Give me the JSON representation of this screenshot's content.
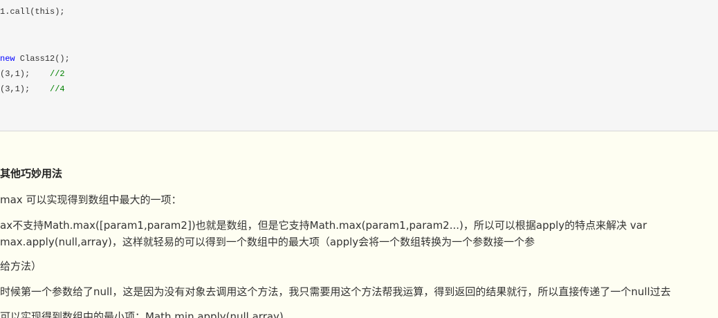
{
  "code": {
    "lines": [
      {
        "code": "1.call(this);",
        "comment": ""
      },
      {
        "code": "",
        "comment": ""
      },
      {
        "code": "",
        "comment": ""
      },
      {
        "kw": "new",
        "code": " Class12();",
        "comment": ""
      },
      {
        "code": "(3,1);    ",
        "comment": "//2"
      },
      {
        "code": "(3,1);    ",
        "comment": "//4"
      }
    ]
  },
  "article": {
    "heading": "其他巧妙用法",
    "p1": "max 可以实现得到数组中最大的一项：",
    "p2a": "ax不支持Math.max([param1,param2])也就是数组，但是它支持Math.max(param1,param2...)，所以可以根据apply的特点来解决 var",
    "p2b": "max.apply(null,array)，这样就轻易的可以得到一个数组中的最大项（apply会将一个数组转换为一个参数接一个参",
    "p3": "给方法）",
    "p4": "时候第一个参数给了null，这是因为没有对象去调用这个方法，我只需要用这个方法帮我运算，得到返回的结果就行，所以直接传递了一个null过去",
    "p5": "可以实现得到数组中的最小项：Math.min.apply(null,array)"
  }
}
